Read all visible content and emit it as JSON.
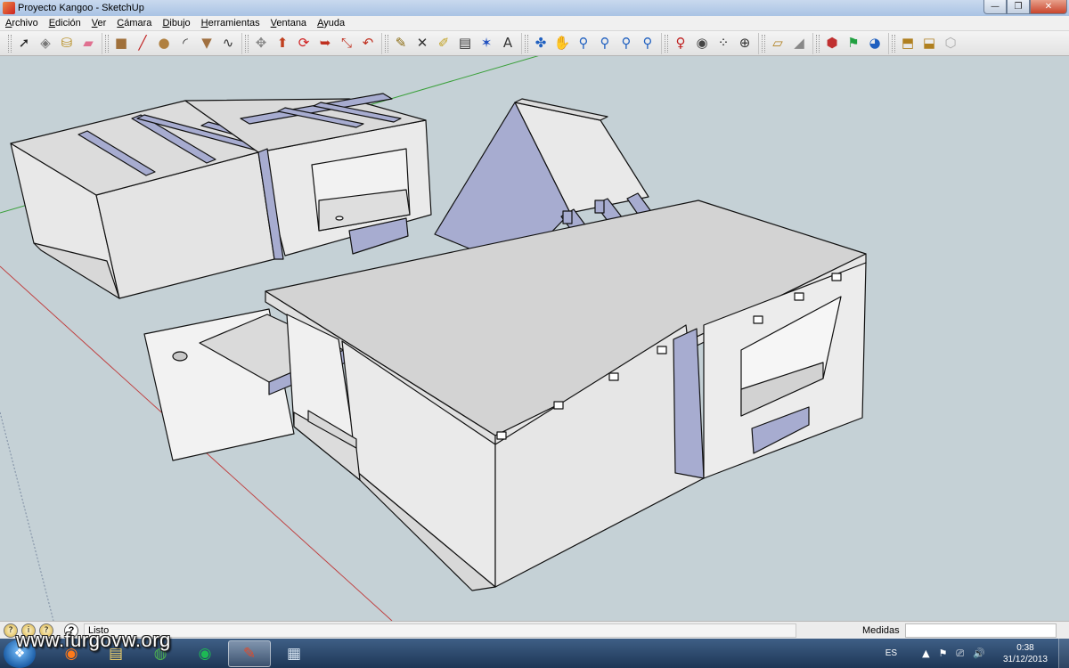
{
  "window": {
    "title": "Proyecto Kangoo - SketchUp"
  },
  "window_controls": {
    "minimize": "—",
    "maximize": "❐",
    "close": "✕"
  },
  "menu": [
    {
      "label": "Archivo",
      "ul": "A",
      "rest": "rchivo"
    },
    {
      "label": "Edición",
      "ul": "E",
      "rest": "dición"
    },
    {
      "label": "Ver",
      "ul": "V",
      "rest": "er"
    },
    {
      "label": "Cámara",
      "ul": "C",
      "rest": "ámara"
    },
    {
      "label": "Dibujo",
      "ul": "D",
      "rest": "ibujo"
    },
    {
      "label": "Herramientas",
      "ul": "H",
      "rest": "erramientas"
    },
    {
      "label": "Ventana",
      "ul": "V",
      "rest": "entana"
    },
    {
      "label": "Ayuda",
      "ul": "A",
      "rest": "yuda"
    }
  ],
  "toolbar": {
    "groups": [
      [
        {
          "name": "select-tool",
          "glyph": "➚",
          "color": "#222"
        },
        {
          "name": "component-tool",
          "glyph": "◈",
          "color": "#777"
        },
        {
          "name": "paint-bucket-tool",
          "glyph": "⛁",
          "color": "#b58a1a"
        },
        {
          "name": "eraser-tool",
          "glyph": "▰",
          "color": "#e07090"
        }
      ],
      [
        {
          "name": "rectangle-tool",
          "glyph": "■",
          "color": "#a0703a"
        },
        {
          "name": "line-tool",
          "glyph": "╱",
          "color": "#c02020"
        },
        {
          "name": "circle-tool",
          "glyph": "●",
          "color": "#b08040"
        },
        {
          "name": "arc-tool",
          "glyph": "◜",
          "color": "#333"
        },
        {
          "name": "polygon-tool",
          "glyph": "▼",
          "color": "#a07040"
        },
        {
          "name": "freehand-tool",
          "glyph": "∿",
          "color": "#333"
        }
      ],
      [
        {
          "name": "move-tool",
          "glyph": "✥",
          "color": "#888"
        },
        {
          "name": "push-pull-tool",
          "glyph": "⬆",
          "color": "#c04020"
        },
        {
          "name": "rotate-tool",
          "glyph": "⟳",
          "color": "#d02020"
        },
        {
          "name": "follow-me-tool",
          "glyph": "➥",
          "color": "#c03020"
        },
        {
          "name": "scale-tool",
          "glyph": "⤡",
          "color": "#c03020"
        },
        {
          "name": "offset-tool",
          "glyph": "↶",
          "color": "#c03020"
        }
      ],
      [
        {
          "name": "tape-measure-tool",
          "glyph": "✎",
          "color": "#8a6a10"
        },
        {
          "name": "dimension-tool",
          "glyph": "✕",
          "color": "#333"
        },
        {
          "name": "protractor-tool",
          "glyph": "✐",
          "color": "#c0a020"
        },
        {
          "name": "text-tool",
          "glyph": "▤",
          "color": "#333"
        },
        {
          "name": "axes-tool",
          "glyph": "✶",
          "color": "#2050c0"
        },
        {
          "name": "3d-text-tool",
          "glyph": "A",
          "color": "#333"
        }
      ],
      [
        {
          "name": "orbit-tool",
          "glyph": "✤",
          "color": "#2060c0"
        },
        {
          "name": "pan-tool",
          "glyph": "✋",
          "color": "#444"
        },
        {
          "name": "zoom-tool",
          "glyph": "⚲",
          "color": "#2060c0"
        },
        {
          "name": "zoom-window-tool",
          "glyph": "⚲",
          "color": "#2060c0"
        },
        {
          "name": "zoom-extents-tool",
          "glyph": "⚲",
          "color": "#2060c0"
        },
        {
          "name": "previous-view-tool",
          "glyph": "⚲",
          "color": "#2060c0"
        }
      ],
      [
        {
          "name": "position-camera-tool",
          "glyph": "♀",
          "color": "#c02020"
        },
        {
          "name": "look-around-tool",
          "glyph": "◉",
          "color": "#444"
        },
        {
          "name": "walk-tool",
          "glyph": "⁘",
          "color": "#222"
        },
        {
          "name": "section-plane-tool",
          "glyph": "⊕",
          "color": "#333"
        }
      ],
      [
        {
          "name": "google-earth-view-tool",
          "glyph": "▱",
          "color": "#b08020"
        },
        {
          "name": "toggle-terrain-tool",
          "glyph": "◢",
          "color": "#888"
        }
      ],
      [
        {
          "name": "add-location-tool",
          "glyph": "⬢",
          "color": "#c03030"
        },
        {
          "name": "photo-textures-tool",
          "glyph": "⚑",
          "color": "#20a040"
        },
        {
          "name": "share-model-tool",
          "glyph": "◕",
          "color": "#2060c0"
        }
      ],
      [
        {
          "name": "3d-warehouse-tool",
          "glyph": "⬒",
          "color": "#b08020"
        },
        {
          "name": "get-models-tool",
          "glyph": "⬓",
          "color": "#b08020"
        },
        {
          "name": "extension-warehouse-tool",
          "glyph": "⬡",
          "color": "#aaa"
        }
      ]
    ]
  },
  "viewport": {
    "sky_color": "#c5d1d6",
    "face_light": "#e6e6e6",
    "face_mid": "#d3d3d3",
    "face_back": "#a7acd0",
    "edge_color": "#111111",
    "axis_red": "#c04040",
    "axis_green": "#3aa03a"
  },
  "status": {
    "icons": [
      "?",
      "i",
      "?"
    ],
    "help_glyph": "?",
    "text": "Listo",
    "measure_label": "Medidas",
    "measure_value": ""
  },
  "taskbar": {
    "start_glyph": "❖",
    "apps": [
      {
        "name": "taskbar-firefox",
        "glyph": "◉",
        "color": "#ff7a1a",
        "active": false
      },
      {
        "name": "taskbar-explorer",
        "glyph": "▤",
        "color": "#f3d36b",
        "active": false
      },
      {
        "name": "taskbar-chrome",
        "glyph": "◍",
        "color": "#4caf50",
        "active": false
      },
      {
        "name": "taskbar-spotify",
        "glyph": "◉",
        "color": "#1db954",
        "active": false
      },
      {
        "name": "taskbar-sketchup",
        "glyph": "✎",
        "color": "#e04a2a",
        "active": true
      },
      {
        "name": "taskbar-calculator",
        "glyph": "▦",
        "color": "#d8e6f3",
        "active": false
      }
    ],
    "watermark": "www.furgovw.org",
    "language": "ES",
    "tray_icons": [
      "▲",
      "⚑",
      "⎚",
      "🔊"
    ],
    "time": "0:38",
    "date": "31/12/2013"
  }
}
